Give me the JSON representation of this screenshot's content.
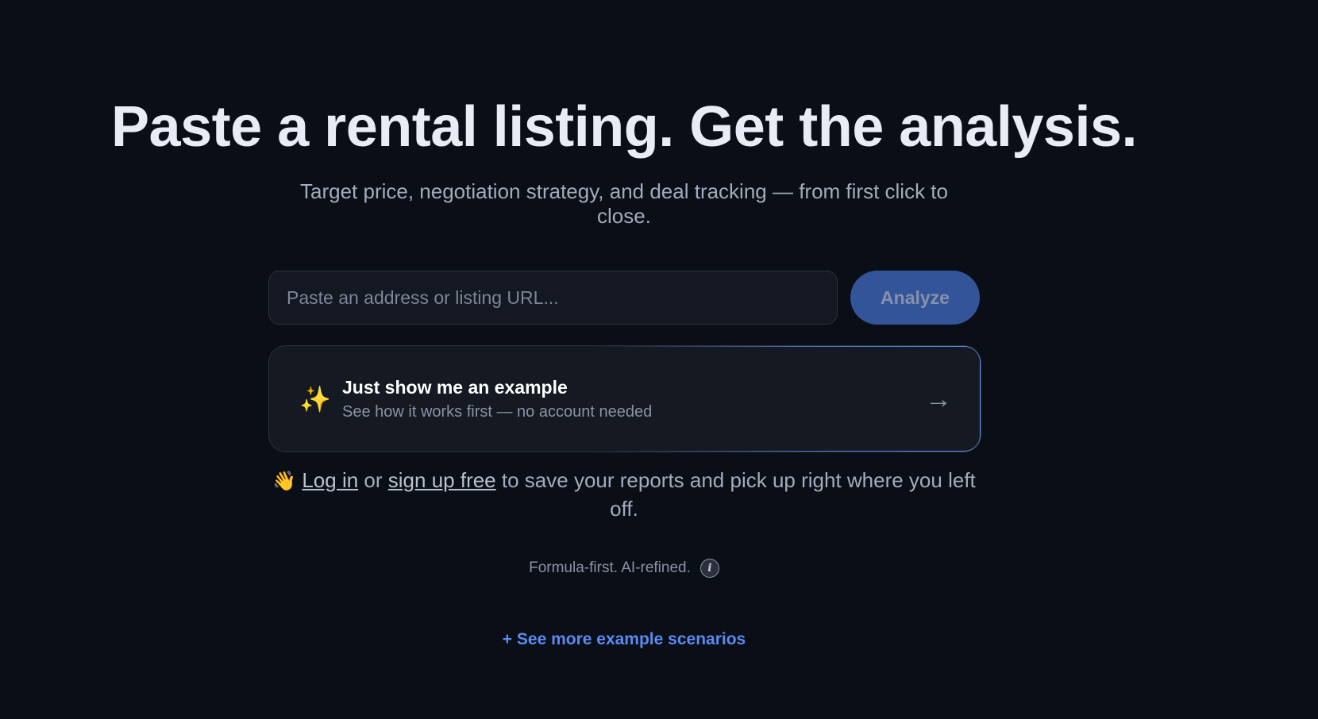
{
  "hero": {
    "title": "Paste a rental listing. Get the analysis.",
    "subtitle": "Target price, negotiation strategy, and deal tracking — from first click to close."
  },
  "search": {
    "placeholder": "Paste an address or listing URL...",
    "value": "",
    "button_label": "Analyze"
  },
  "example_card": {
    "icon": "sparkles-icon",
    "icon_glyph": "✨",
    "title": "Just show me an example",
    "subtitle": "See how it works first — no account needed",
    "arrow_glyph": "→"
  },
  "auth": {
    "wave_glyph": "👋",
    "login_label": "Log in",
    "or_text": "or",
    "signup_label": "sign up free",
    "rest_text": "to save your reports and pick up right where you left off."
  },
  "footer": {
    "tagline": "Formula-first. AI-refined.",
    "info_glyph": "i",
    "more_label": "+ See more example scenarios"
  },
  "colors": {
    "background": "#0a0e16",
    "accent": "#5b8af0",
    "button": "#34549a"
  }
}
